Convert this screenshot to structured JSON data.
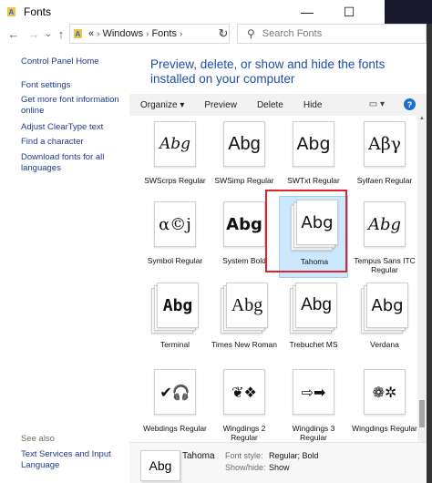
{
  "window": {
    "title": "Fonts"
  },
  "titlebar": {
    "minimize": "—",
    "maximize": "☐",
    "close": "✕"
  },
  "nav": {
    "back": "←",
    "forward": "→",
    "recent": "⌄",
    "up": "↑",
    "refresh": "↻"
  },
  "address": {
    "prefix": "«",
    "crumbs": [
      "Windows",
      "Fonts"
    ],
    "separator": "›"
  },
  "search": {
    "placeholder": "Search Fonts"
  },
  "sidebar": {
    "links": [
      "Control Panel Home",
      "Font settings",
      "Get more font information online",
      "Adjust ClearType text",
      "Find a character",
      "Download fonts for all languages"
    ],
    "see_also_label": "See also",
    "see_also_links": [
      "Text Services and Input Language"
    ]
  },
  "main": {
    "heading": "Preview, delete, or show and hide the fonts installed on your computer"
  },
  "toolbar": {
    "organize": "Organize ▾",
    "preview": "Preview",
    "delete": "Delete",
    "hide": "Hide",
    "view_icon": "view-options-icon",
    "help": "?"
  },
  "fonts": [
    {
      "name": "SWScrps Regular",
      "sample": "Abg",
      "stack": false
    },
    {
      "name": "SWSimp Regular",
      "sample": "Abg",
      "stack": false
    },
    {
      "name": "SWTxt Regular",
      "sample": "Abg",
      "stack": false
    },
    {
      "name": "Sylfaen Regular",
      "sample": "Αβγ",
      "stack": false
    },
    {
      "name": "Symbol Regular",
      "sample": "α©ϳ",
      "stack": false
    },
    {
      "name": "System Bold",
      "sample": "Abg",
      "stack": false
    },
    {
      "name": "Tahoma",
      "sample": "Abg",
      "stack": true,
      "selected": true
    },
    {
      "name": "Tempus Sans ITC Regular",
      "sample": "Abg",
      "stack": false
    },
    {
      "name": "Terminal",
      "sample": "Abg",
      "stack": true
    },
    {
      "name": "Times New Roman",
      "sample": "Abg",
      "stack": true
    },
    {
      "name": "Trebuchet MS",
      "sample": "Abg",
      "stack": true
    },
    {
      "name": "Verdana",
      "sample": "Abg",
      "stack": true
    },
    {
      "name": "Webdings Regular",
      "sample": "✔🎧",
      "stack": false
    },
    {
      "name": "Wingdings 2 Regular",
      "sample": "❦❖",
      "stack": false
    },
    {
      "name": "Wingdings 3 Regular",
      "sample": "⇨➡",
      "stack": false
    },
    {
      "name": "Wingdings Regular",
      "sample": "❁✲",
      "stack": false
    }
  ],
  "details": {
    "thumb_sample": "Abg",
    "name": "Tahoma",
    "font_style_label": "Font style:",
    "font_style_value": "Regular; Bold",
    "show_hide_label": "Show/hide:",
    "show_hide_value": "Show"
  },
  "colors": {
    "link": "#1e3b8c",
    "heading": "#1e4ea8",
    "selection": "#cce8ff",
    "highlight_box": "#e0222b"
  }
}
